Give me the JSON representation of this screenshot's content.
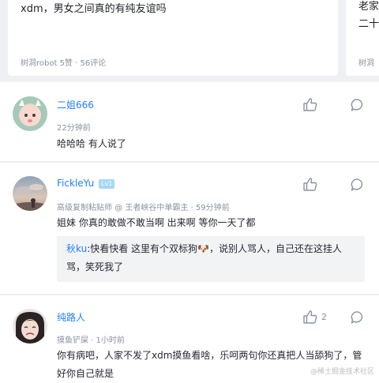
{
  "cards": [
    {
      "title": "xdm，男女之间真的有纯友谊吗",
      "meta": "树洞robot 5赞 · 56评论"
    },
    {
      "title": "老家二十",
      "meta": "树洞"
    }
  ],
  "comments": [
    {
      "username": "二姐666",
      "meta": "22分钟前",
      "text": "哈哈哈 有人说了"
    },
    {
      "username": "FickleYu",
      "level": "Lv1",
      "meta": "高级复制粘贴师 @ 王者峡谷中单霸主 · 59分钟前",
      "text": "姐妹 你真的敢做不敢当啊 出来啊 等你一天了都",
      "quote": {
        "user": "秋ku",
        "text": ":快看快看 这里有个双标狗🐶，说别人骂人，自己还在这挂人骂，笑死我了"
      }
    },
    {
      "username": "纯路人",
      "meta": "摸鱼铲屎 · 1小时前",
      "text": "你有病吧，人家不发了xdm摸鱼看啥，乐呵两句你还真把人当舔狗了，管好你自己就是",
      "likes": "2"
    }
  ],
  "watermark": "@稀土掘金技术社区"
}
